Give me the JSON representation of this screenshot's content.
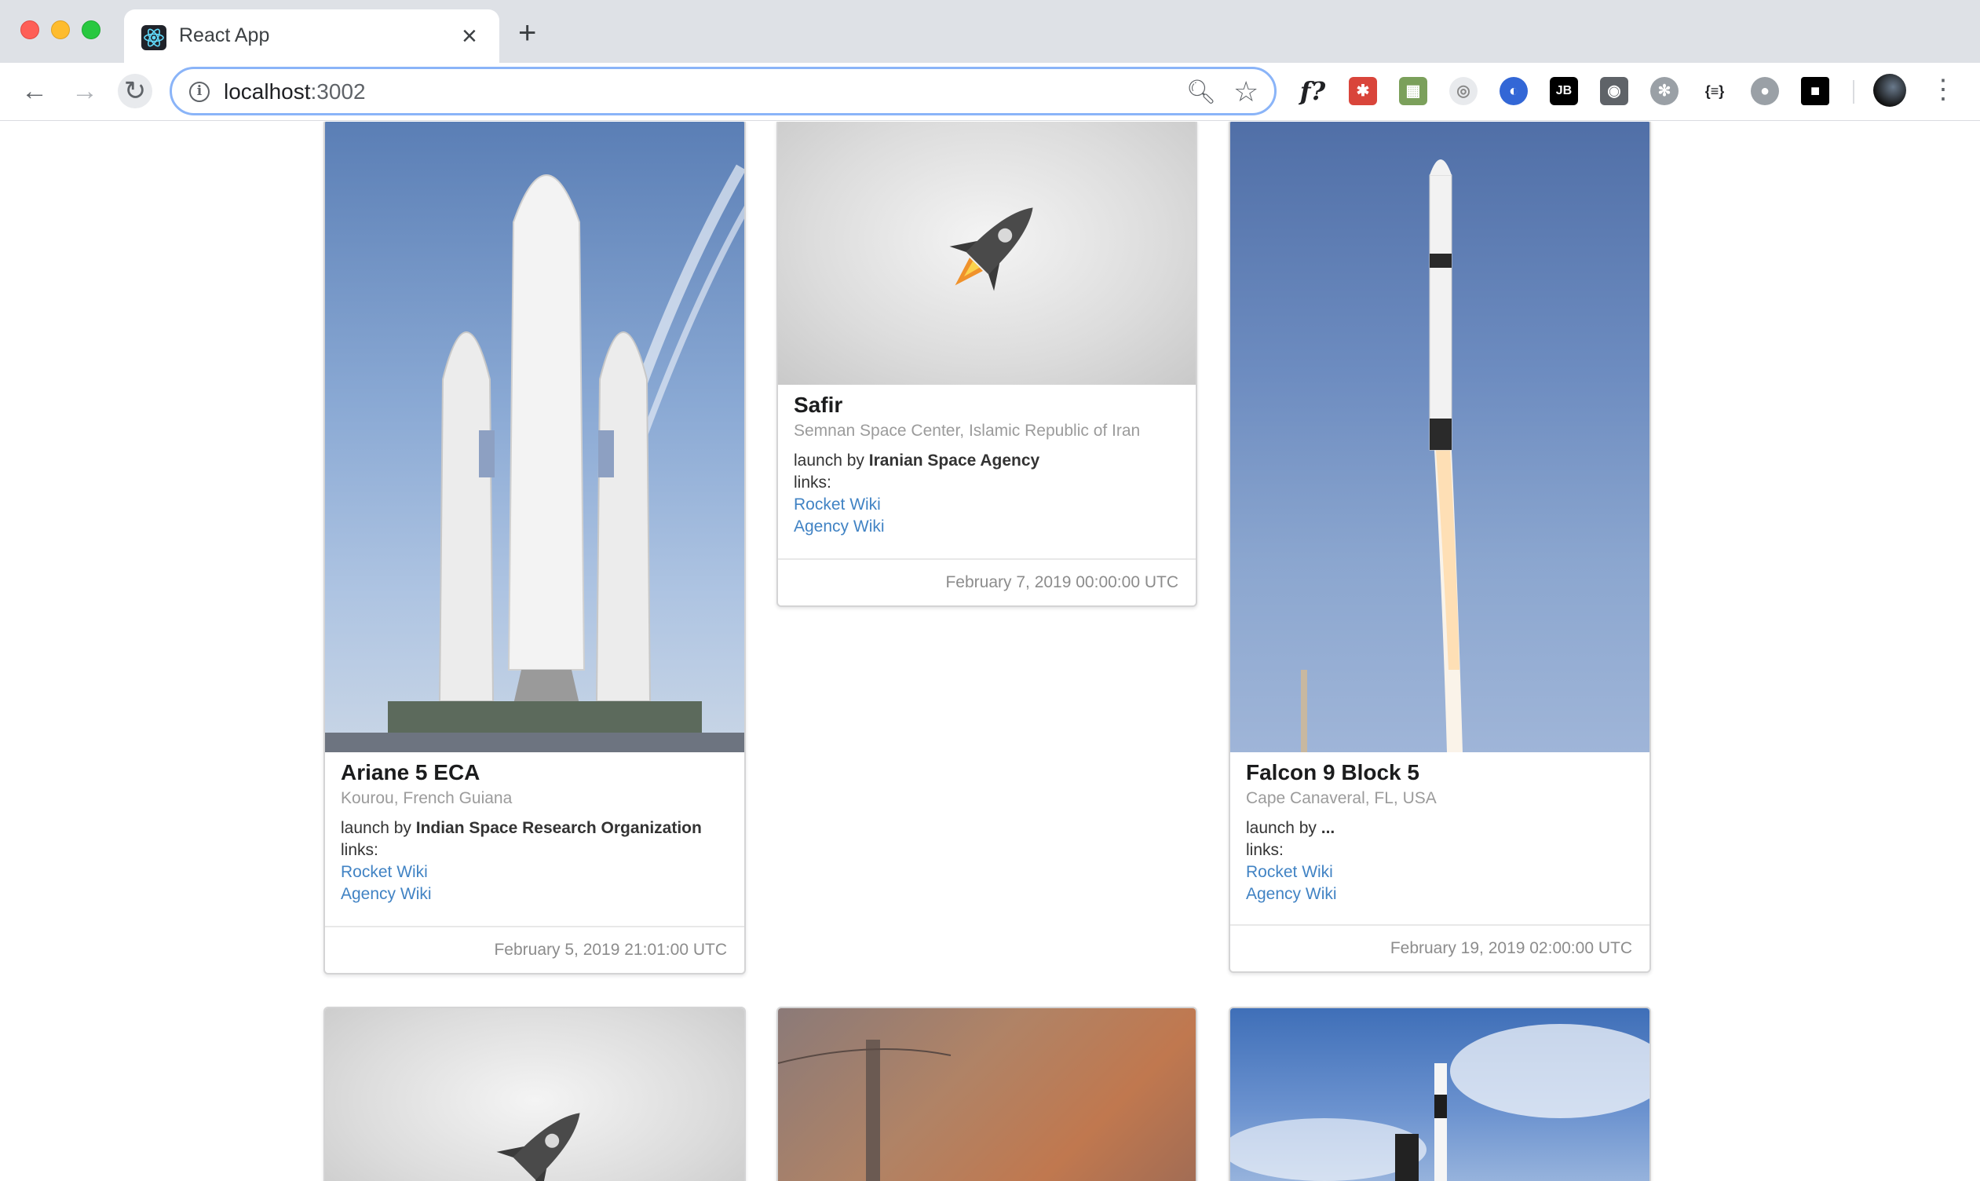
{
  "browser": {
    "tab_title": "React App",
    "url_host": "localhost",
    "url_port": ":3002",
    "extensions": [
      "function-ext-icon",
      "ext-red-icon",
      "ext-globe-icon",
      "ext-target-icon",
      "ext-blue-circle-icon",
      "jetbrains-icon",
      "lightbulb-icon",
      "ext-gear-icon",
      "json-ext-icon",
      "bug-icon",
      "video-camera-icon"
    ]
  },
  "cards": [
    {
      "title": "Ariane 5 ECA",
      "location": "Kourou, French Guiana",
      "launch_prefix": "launch by ",
      "agency": "Indian Space Research Organization",
      "links_label": "links:",
      "rocket_wiki": "Rocket Wiki",
      "agency_wiki": "Agency Wiki",
      "date": "February 5, 2019 21:01:00 UTC"
    },
    {
      "title": "Safir",
      "location": "Semnan Space Center, Islamic Republic of Iran",
      "launch_prefix": "launch by ",
      "agency": "Iranian Space Agency",
      "links_label": "links:",
      "rocket_wiki": "Rocket Wiki",
      "agency_wiki": "Agency Wiki",
      "date": "February 7, 2019 00:00:00 UTC"
    },
    {
      "title": "Falcon 9 Block 5",
      "location": "Cape Canaveral, FL, USA",
      "launch_prefix": "launch by ",
      "agency": "...",
      "links_label": "links:",
      "rocket_wiki": "Rocket Wiki",
      "agency_wiki": "Agency Wiki",
      "date": "February 19, 2019 02:00:00 UTC"
    }
  ]
}
